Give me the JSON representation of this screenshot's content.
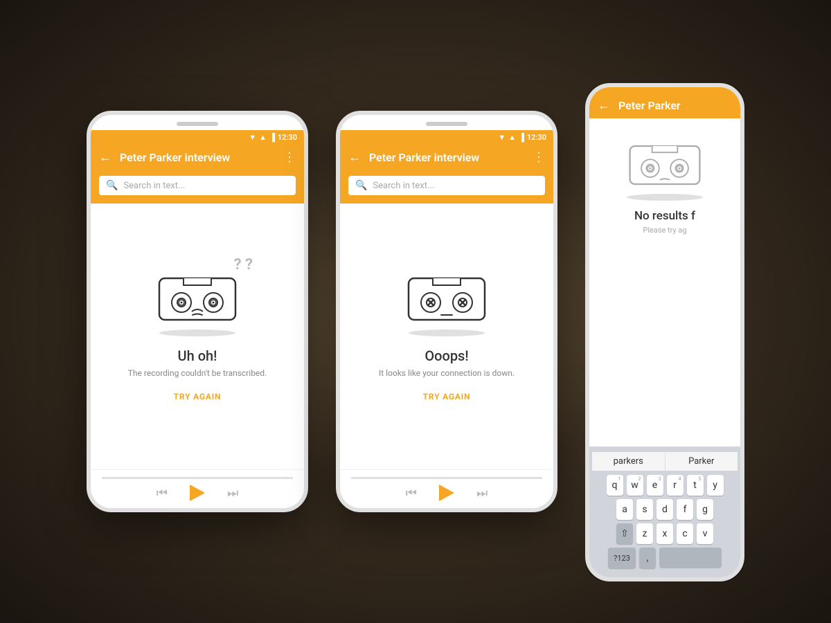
{
  "background": "#3a2e20",
  "accent_color": "#F5A623",
  "phone1": {
    "status_bar": {
      "time": "12:30"
    },
    "app_bar": {
      "title": "Peter Parker interview",
      "back_label": "←",
      "menu_label": "⋮"
    },
    "search": {
      "placeholder": "Search in text..."
    },
    "error": {
      "title": "Uh oh!",
      "subtitle": "The recording couldn't be transcribed.",
      "cta": "TRY AGAIN"
    },
    "player": {
      "skip_back": "⏮",
      "skip_forward": "⏭"
    }
  },
  "phone2": {
    "status_bar": {
      "time": "12:30"
    },
    "app_bar": {
      "title": "Peter Parker interview",
      "back_label": "←",
      "menu_label": "⋮"
    },
    "search": {
      "placeholder": "Search in text..."
    },
    "error": {
      "title": "Ooops!",
      "subtitle": "It looks like your connection is down.",
      "cta": "TRY AGAIN"
    }
  },
  "phone3": {
    "app_bar": {
      "title": "Peter Parker",
      "back_label": "←"
    },
    "no_results": {
      "title": "No results f",
      "subtitle": "Please try ag"
    },
    "keyboard": {
      "suggestions": [
        "parkers",
        "Parker"
      ],
      "rows": [
        [
          "q",
          "w",
          "e",
          "r",
          "t",
          "y"
        ],
        [
          "a",
          "s",
          "d",
          "f",
          "g"
        ],
        [
          "z",
          "x",
          "c",
          "v"
        ],
        [
          "?123",
          ",",
          " "
        ]
      ],
      "nums": [
        "1",
        "2",
        "3",
        "4",
        "5"
      ]
    }
  }
}
